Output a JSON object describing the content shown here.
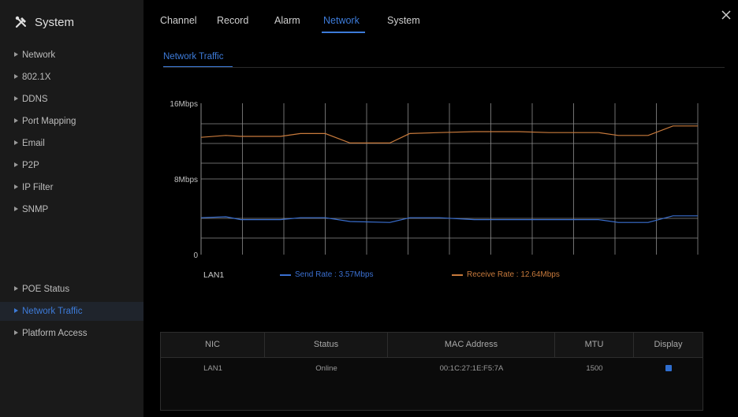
{
  "sidebar": {
    "title": "System",
    "icon": "tools-icon",
    "items": [
      {
        "label": "Network"
      },
      {
        "label": "802.1X"
      },
      {
        "label": "DDNS"
      },
      {
        "label": "Port Mapping"
      },
      {
        "label": "Email"
      },
      {
        "label": "P2P"
      },
      {
        "label": "IP Filter"
      },
      {
        "label": "SNMP"
      },
      {
        "label": "POE Status"
      },
      {
        "label": "Network Traffic",
        "active": true
      },
      {
        "label": "Platform Access"
      }
    ]
  },
  "top_tabs": [
    {
      "label": "Channel"
    },
    {
      "label": "Record"
    },
    {
      "label": "Alarm"
    },
    {
      "label": "Network",
      "active": true
    },
    {
      "label": "System"
    }
  ],
  "sub_tab": {
    "label": "Network Traffic"
  },
  "colors": {
    "accent": "#3d7bd9",
    "send": "#3a6fd0",
    "receive": "#c87a3c"
  },
  "chart_data": {
    "type": "line",
    "y_ticks": [
      "16Mbps",
      "8Mbps",
      "0"
    ],
    "ylim": [
      0,
      16
    ],
    "grid": true,
    "legend": "bottom",
    "nic_label": "LAN1",
    "legend_send": "Send Rate : 3.57Mbps",
    "legend_receive": "Receive Rate : 12.64Mbps",
    "series": [
      {
        "name": "Send Rate : 3.57Mbps",
        "color": "#3a6fd0",
        "x": [
          0,
          5,
          8,
          16,
          20,
          25,
          30,
          38,
          42,
          48,
          55,
          60,
          64,
          70,
          75,
          80,
          84,
          90,
          95,
          100
        ],
        "values": [
          3.9,
          4.0,
          3.7,
          3.7,
          3.9,
          3.9,
          3.5,
          3.4,
          3.9,
          3.9,
          3.7,
          3.7,
          3.7,
          3.7,
          3.7,
          3.7,
          3.4,
          3.4,
          4.1,
          4.1
        ]
      },
      {
        "name": "Receive Rate : 12.64Mbps",
        "color": "#c87a3c",
        "x": [
          0,
          5,
          8,
          16,
          20,
          25,
          30,
          38,
          42,
          48,
          55,
          60,
          64,
          70,
          75,
          80,
          84,
          90,
          95,
          100
        ],
        "values": [
          12.4,
          12.6,
          12.5,
          12.5,
          12.8,
          12.8,
          11.8,
          11.8,
          12.8,
          12.9,
          13.0,
          13.0,
          13.0,
          12.9,
          12.9,
          12.9,
          12.6,
          12.6,
          13.6,
          13.6
        ]
      }
    ]
  },
  "table": {
    "headers": [
      "NIC",
      "Status",
      "MAC Address",
      "MTU",
      "Display"
    ],
    "rows": [
      {
        "nic": "LAN1",
        "status": "Online",
        "mac": "00:1C:27:1E:F5:7A",
        "mtu": "1500",
        "display": true
      }
    ]
  }
}
